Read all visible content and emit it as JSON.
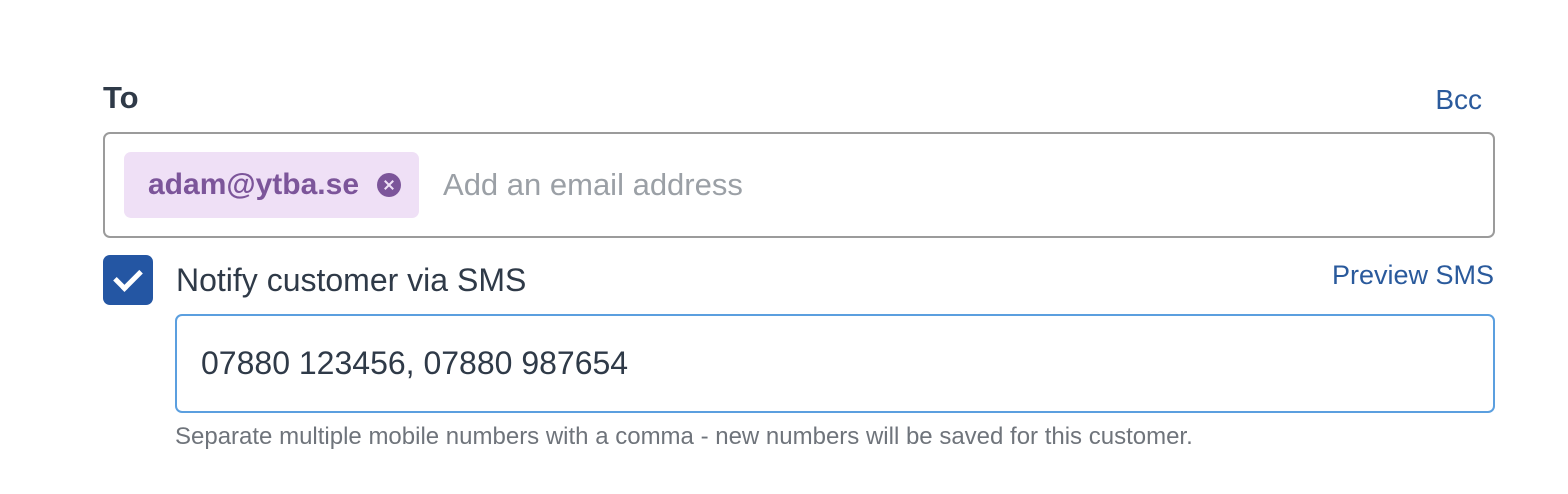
{
  "recipients": {
    "to_label": "To",
    "bcc_link": "Bcc",
    "chips": [
      {
        "email": "adam@ytba.se"
      }
    ],
    "input_placeholder": "Add an email address"
  },
  "sms": {
    "checked": true,
    "label": "Notify customer via SMS",
    "preview_link": "Preview SMS",
    "phone_value": "07880 123456, 07880 987654",
    "hint": "Separate multiple mobile numbers with a comma - new numbers will be saved for this customer."
  },
  "colors": {
    "accent": "#2456a3",
    "link": "#2a5a9c",
    "chip_bg": "#efe0f6",
    "chip_text": "#7c559a",
    "focus_border": "#5b9fdf"
  },
  "icons": {
    "chip_remove": "close-circle-icon",
    "checkbox": "checkmark-icon"
  }
}
